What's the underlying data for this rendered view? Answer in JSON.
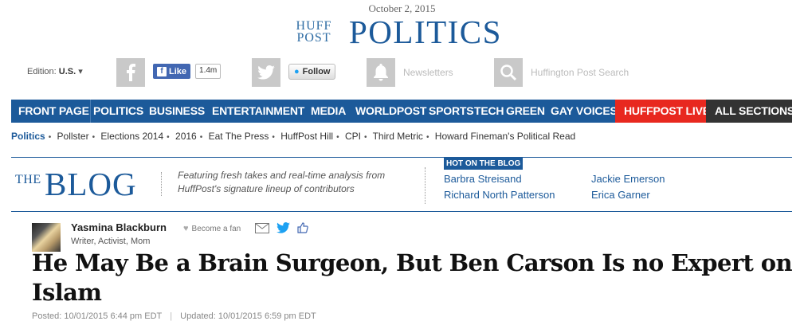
{
  "header": {
    "date": "October 2, 2015",
    "logo_line1": "HUFF",
    "logo_line2": "POST",
    "section_title": "POLITICS"
  },
  "utility": {
    "edition_label": "Edition:",
    "edition_value": "U.S.",
    "fb_like_label": "Like",
    "fb_like_count": "1.4m",
    "twitter_follow_label": "Follow",
    "newsletters_label": "Newsletters",
    "search_placeholder": "Huffington Post Search"
  },
  "nav": {
    "items": [
      "FRONT PAGE",
      "POLITICS",
      "BUSINESS",
      "ENTERTAINMENT",
      "MEDIA",
      "WORLDPOST",
      "SPORTS",
      "TECH",
      "GREEN",
      "GAY VOICES"
    ],
    "live": "HUFFPOST LIVE",
    "all": "ALL SECTIONS",
    "colors": {
      "nav_bg": "#1c5a9a",
      "live_bg": "#e8281f",
      "all_bg": "#333333"
    }
  },
  "subnav": {
    "items": [
      "Politics",
      "Pollster",
      "Elections 2014",
      "2016",
      "Eat The Press",
      "HuffPost Hill",
      "CPI",
      "Third Metric",
      "Howard Fineman's Political Read"
    ]
  },
  "blog": {
    "the": "THE",
    "blog": "BLOG",
    "tagline": "Featuring fresh takes and real-time analysis from HuffPost's signature lineup of contributors",
    "hot_label": "HOT ON THE BLOG",
    "hot_links": [
      "Barbra Streisand",
      "Jackie Emerson",
      "Richard North Patterson",
      "Erica Garner"
    ]
  },
  "author": {
    "name": "Yasmina Blackburn",
    "role": "Writer, Activist, Mom",
    "fan_label": "Become a fan"
  },
  "article": {
    "headline": "He May Be a Brain Surgeon, But Ben Carson Is no Expert on Islam",
    "posted": "Posted: 10/01/2015 6:44 pm EDT",
    "updated": "Updated: 10/01/2015 6:59 pm EDT"
  },
  "icons": [
    "facebook-icon",
    "twitter-icon",
    "bell-icon",
    "search-icon",
    "heart-icon",
    "email-icon",
    "thumbs-up-icon"
  ]
}
